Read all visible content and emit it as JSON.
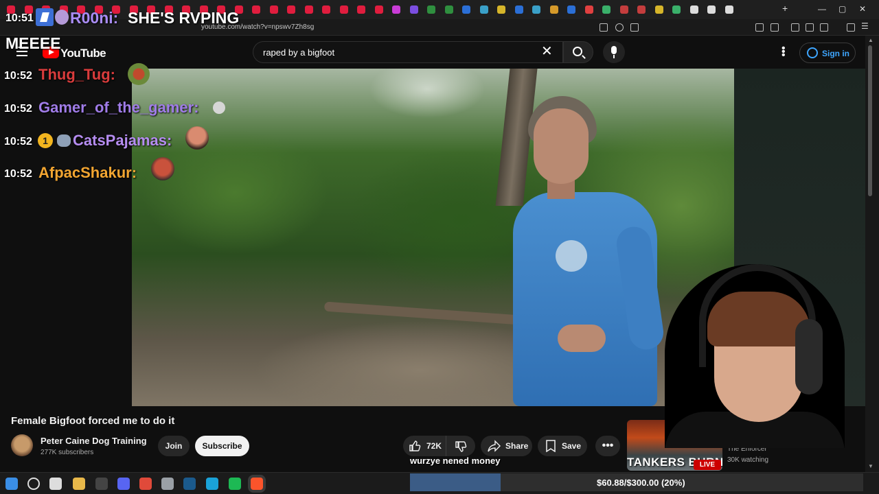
{
  "browser": {
    "url": "youtube.com/watch?v=npswv7Zh8sg",
    "tab_colors": [
      "#e01d3e",
      "#e01d3e",
      "#e01d3e",
      "#e01d3e",
      "#e01d3e",
      "#e01d3e",
      "#e01d3e",
      "#e01d3e",
      "#e01d3e",
      "#e01d3e",
      "#e01d3e",
      "#e01d3e",
      "#e01d3e",
      "#e01d3e",
      "#e01d3e",
      "#e01d3e",
      "#e01d3e",
      "#e01d3e",
      "#e01d3e",
      "#e01d3e",
      "#e01d3e",
      "#e01d3e",
      "#c93cd6",
      "#7b4ee0",
      "#2f8f3f",
      "#2f8f3f",
      "#2b6fd6",
      "#3aa0c8",
      "#d6b52a",
      "#2b6fd6",
      "#3aa0c8",
      "#d69a2a",
      "#2b6fd6",
      "#e04040",
      "#3ab06a",
      "#c43d3d",
      "#c43d3d",
      "#d6b52a",
      "#3ab06a",
      "#dddddd",
      "#dddddd",
      "#dddddd"
    ]
  },
  "overlay": {
    "top_message": {
      "time": "10:51",
      "user": "R00ni:",
      "text": "SHE'S RVPING",
      "text_line2": "MEEEE"
    },
    "chat": [
      {
        "time": "10:52",
        "user": "Thug_Tug:",
        "color": "#d93c3c",
        "emote_color": "#6b8a3a"
      },
      {
        "time": "10:52",
        "user": "Gamer_of_the_gamer:",
        "color": "#a07ce8",
        "emote_color": "#d6d6d6"
      },
      {
        "time": "10:52",
        "user": "CatsPajamas:",
        "color": "#b58cf0",
        "sub_badge": "1",
        "emote_color": "#d98b70"
      },
      {
        "time": "10:52",
        "user": "AfpacShakur:",
        "color": "#f2a531",
        "emote_color": "#c9523c"
      }
    ]
  },
  "header": {
    "logo_text": "YouTube",
    "search_query": "raped by a bigfoot",
    "signin_label": "Sign in"
  },
  "video": {
    "title": "Female Bigfoot forced me to do it",
    "channel_name": "Peter Caine Dog Training",
    "subscribers": "277K subscribers",
    "join_label": "Join",
    "subscribe_label": "Subscribe",
    "likes": "72K",
    "share_label": "Share",
    "save_label": "Save"
  },
  "donation": {
    "message": "wurzye nened money",
    "progress_text": "$60.88/$300.00 (20%)",
    "progress_fraction": 0.2
  },
  "recommended": {
    "thumb_caption": "TANKERS BURN",
    "live_badge": "LIVE",
    "channel": "The Enforcer",
    "watching": "30K watching"
  },
  "taskbar": {
    "icons": [
      {
        "name": "windows-start-icon",
        "color": "#3a8ee6"
      },
      {
        "name": "search-icon",
        "color": "#dddddd"
      },
      {
        "name": "task-view-icon",
        "color": "#dddddd"
      },
      {
        "name": "file-explorer-icon",
        "color": "#e8b84a"
      },
      {
        "name": "obs-icon",
        "color": "#444444"
      },
      {
        "name": "discord-icon",
        "color": "#5865f2"
      },
      {
        "name": "chrome-icon",
        "color": "#e04a3a"
      },
      {
        "name": "app-icon",
        "color": "#9aa0a6"
      },
      {
        "name": "steam-icon",
        "color": "#1b5a8c"
      },
      {
        "name": "edge-icon",
        "color": "#1aa2d8"
      },
      {
        "name": "spotify-icon",
        "color": "#1db954"
      },
      {
        "name": "brave-icon",
        "color": "#fb542b"
      }
    ]
  }
}
